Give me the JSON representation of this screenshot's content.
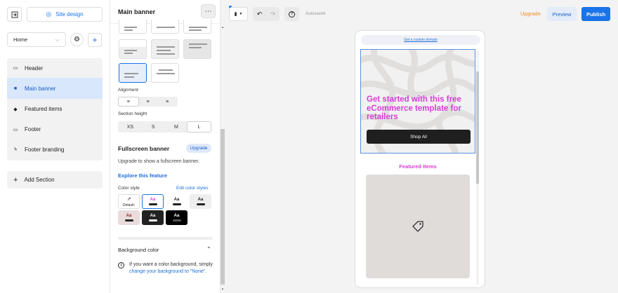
{
  "leftnav": {
    "site_design_label": "Site design",
    "page_select_value": "Home",
    "sections": [
      {
        "label": "Header",
        "icon": "header-icon"
      },
      {
        "label": "Main banner",
        "icon": "bookmark-icon",
        "selected": true
      },
      {
        "label": "Featured items",
        "icon": "tag-icon"
      },
      {
        "label": "Footer",
        "icon": "footer-icon"
      },
      {
        "label": "Footer branding",
        "icon": "bolt-icon"
      }
    ],
    "add_section_label": "Add Section"
  },
  "panel": {
    "title": "Main banner",
    "alignment_label": "Alignment",
    "section_height_label": "Section height",
    "heights": [
      "XS",
      "S",
      "M",
      "L"
    ],
    "selected_height": "L",
    "fullscreen_title": "Fullscreen banner",
    "upgrade_badge": "Upgrade",
    "fullscreen_desc": "Upgrade to show a fullscreen banner.",
    "explore_link": "Explore this feature",
    "color_style_label": "Color style",
    "edit_color_styles": "Edit color styles",
    "default_label": "Default:",
    "swatch_text": "Aa",
    "bg_color_label": "Background color",
    "bg_info_prefix": "If you want a color background, simply ",
    "bg_info_link": "change your background to \"None\"",
    "bg_info_suffix": "."
  },
  "topbar": {
    "autosaved": "Autosaved",
    "upgrade": "Upgrade",
    "preview": "Preview",
    "publish": "Publish"
  },
  "preview": {
    "custom_domain_link": "Get a custom domain",
    "banner_heading": "Get started with this free eCommerce template for retailers",
    "shop_button": "Shop All",
    "featured_title": "Featured Items"
  },
  "colors": {
    "accent_blue": "#1a73e8",
    "selected_bg": "#d8e7fb",
    "upgrade_orange": "#f08c2b",
    "heading_pink": "#d63ed6"
  }
}
